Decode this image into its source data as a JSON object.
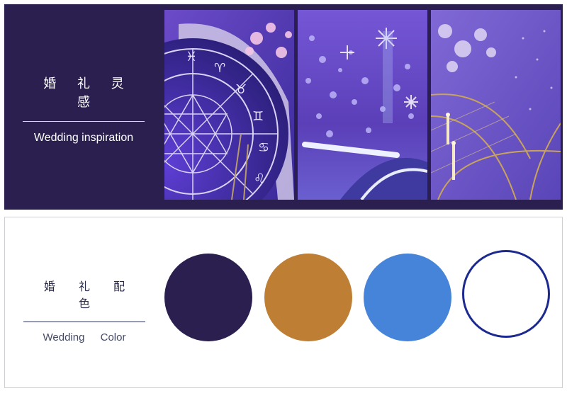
{
  "inspiration": {
    "title_cn": "婚 礼 灵 感",
    "title_en": "Wedding inspiration",
    "photos": [
      {
        "name": "zodiac-wheel-photo"
      },
      {
        "name": "bokeh-stars-photo"
      },
      {
        "name": "gold-arches-photo"
      }
    ]
  },
  "palette": {
    "title_cn": "婚 礼 配 色",
    "title_en": "Wedding Color",
    "colors": [
      {
        "hex": "#2a1f4e"
      },
      {
        "hex": "#be7f35"
      },
      {
        "hex": "#4584d8"
      },
      {
        "hex": "#ffffff",
        "border": "#1c2a8f"
      }
    ]
  }
}
